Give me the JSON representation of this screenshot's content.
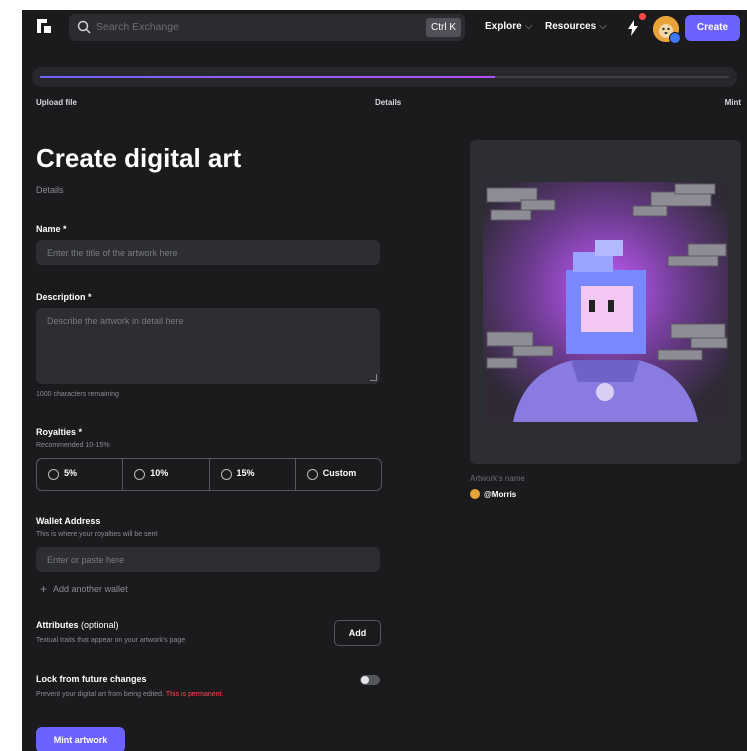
{
  "header": {
    "search_placeholder": "Search Exchange",
    "shortcut": "Ctrl K",
    "nav": [
      {
        "label": "Explore",
        "chevron": "⌵"
      },
      {
        "label": "Resources",
        "chevron": "⌵"
      }
    ],
    "create_label": "Create",
    "notification_color": "#ff4a4a",
    "accent_color": "#6c63ff"
  },
  "stepper": {
    "steps": [
      "Upload file",
      "Details",
      "Mint"
    ],
    "progress": 0.66
  },
  "form": {
    "title": "Create digital art",
    "subtitle": "Details",
    "name": {
      "label": "Name *",
      "placeholder": "Enter the title of the artwork here"
    },
    "description": {
      "label": "Description *",
      "placeholder": "Describe the artwork in detail here",
      "counter": "1000 characters remaining"
    },
    "royalties": {
      "label": "Royalties *",
      "hint": "Recommended 10-15%",
      "options": [
        "5%",
        "10%",
        "15%",
        "Custom"
      ]
    },
    "wallet": {
      "label": "Wallet Address",
      "hint": "This is where your royalties will be sent",
      "placeholder": "Enter or paste here",
      "add_label": "Add another wallet"
    },
    "attributes": {
      "label": "Attributes",
      "optional": "(optional)",
      "hint": "Textual traits that appear on your artwork's page",
      "button": "Add"
    },
    "lock": {
      "label": "Lock from future changes",
      "hint": "Prevent your digital art from being edited.",
      "warning": "This is permanent.",
      "enabled": false
    },
    "submit_label": "Mint artwork"
  },
  "preview": {
    "artwork_name": "Artwork's name",
    "creator": "@Morris"
  },
  "icons": [
    "logo-icon",
    "search-icon",
    "bolt-icon",
    "plus-icon",
    "chevron-down-icon"
  ]
}
